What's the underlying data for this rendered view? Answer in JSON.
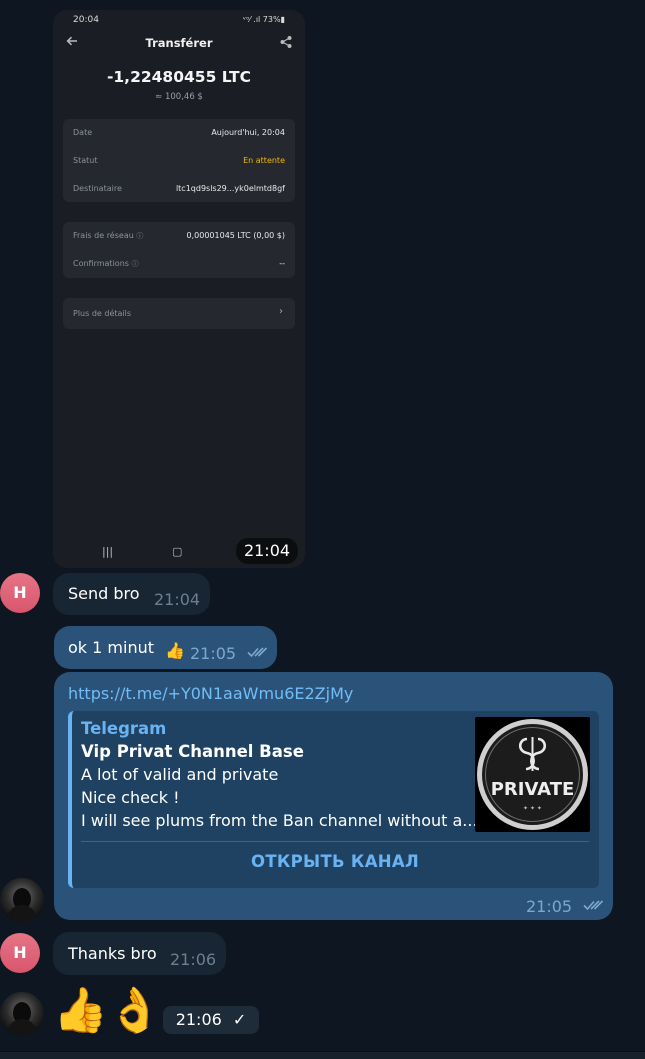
{
  "phone_screenshot": {
    "status_time": "20:04",
    "status_right": "ᵛᵒ⁄ .ıl 73%▮",
    "header_title": "Transférer",
    "amount": "-1,22480455 LTC",
    "approx_value": "≈ 100,46 $",
    "details": [
      {
        "label": "Date",
        "value": "Aujourd'hui, 20:04"
      },
      {
        "label": "Statut",
        "value": "En attente"
      },
      {
        "label": "Destinataire",
        "value": "ltc1qd9sls29...yk0elmtd8gf"
      }
    ],
    "fees": [
      {
        "label": "Frais de réseau",
        "value": "0,00001045 LTC (0,00 $)"
      },
      {
        "label": "Confirmations",
        "value": "--"
      }
    ],
    "more_details": "Plus de détails",
    "nav_recent": "|||",
    "nav_home": "▢",
    "message_time": "21:04"
  },
  "messages": [
    {
      "avatar": "H",
      "text": "Send bro",
      "time": "21:04"
    },
    {
      "text": "ok 1 minut",
      "reaction": "👍",
      "time": "21:05"
    },
    {
      "link": "https://t.me/+Y0N1aaWmu6E2ZjMy",
      "preview": {
        "site": "Telegram",
        "title": "Vip Privat Channel Base",
        "desc1": "A lot of valid and private",
        "desc2": "Nice check !",
        "desc3": "I will see plums from the Ban channel without a...",
        "thumb_text": "PRIVATE",
        "thumb_dots": "✦ ✦ ✦",
        "button": "ОТКРЫТЬ КАНАЛ"
      },
      "time": "21:05"
    },
    {
      "avatar": "H",
      "text": "Thanks bro",
      "time": "21:06"
    },
    {
      "emoji1": "👍",
      "emoji2": "👌",
      "time": "21:06"
    }
  ],
  "colors": {
    "background": "#0e1621",
    "incoming": "#182533",
    "outgoing": "#2b5278",
    "link": "#6ab3f3",
    "pending": "#f0b90b"
  }
}
